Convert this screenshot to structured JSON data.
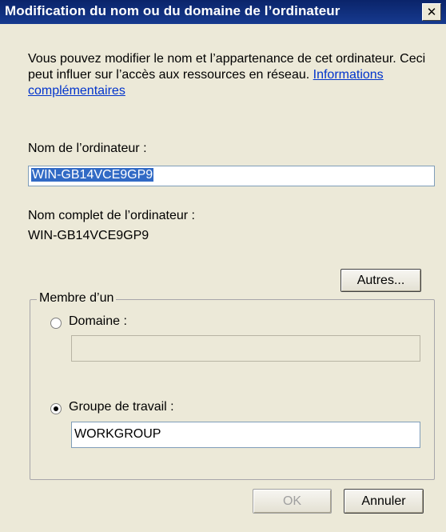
{
  "window": {
    "title": "Modification du nom ou du domaine de l’ordinateur",
    "close_glyph": "✕"
  },
  "description": {
    "text": "Vous pouvez modifier le nom et l’appartenance de cet ordinateur. Ceci peut influer sur l’accès aux ressources en réseau.",
    "link": "Informations complémentaires"
  },
  "computer_name": {
    "label": "Nom de l’ordinateur :",
    "value": "WIN-GB14VCE9GP9"
  },
  "full_name": {
    "label": "Nom complet de l’ordinateur :",
    "value": "WIN-GB14VCE9GP9"
  },
  "more_button": "Autres...",
  "member_of": {
    "legend": "Membre d’un",
    "domain": {
      "label": "Domaine :",
      "value": "",
      "selected": false
    },
    "workgroup": {
      "label": "Groupe de travail :",
      "value": "WORKGROUP",
      "selected": true
    }
  },
  "buttons": {
    "ok": "OK",
    "cancel": "Annuler"
  },
  "colors": {
    "titlebar": "#0a246a",
    "dialog_bg": "#ece9d8",
    "selection": "#316ac5",
    "link": "#0033cc"
  }
}
